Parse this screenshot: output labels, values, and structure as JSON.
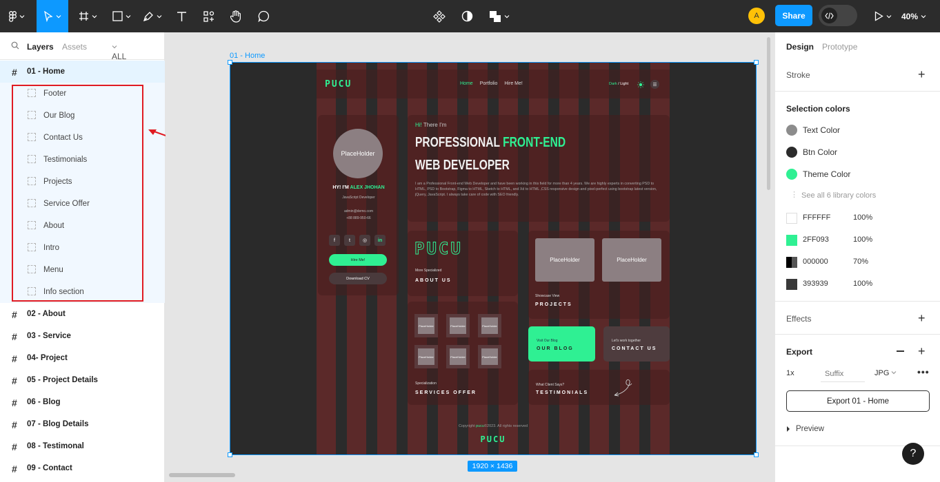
{
  "toolbar": {
    "share": "Share",
    "avatar": "A",
    "zoom": "40%"
  },
  "left": {
    "tab_layers": "Layers",
    "tab_assets": "Assets",
    "pages": "ALL page",
    "layers": [
      {
        "label": "01 - Home"
      },
      {
        "label": "Footer"
      },
      {
        "label": "Our Blog"
      },
      {
        "label": "Contact Us"
      },
      {
        "label": "Testimonials"
      },
      {
        "label": "Projects"
      },
      {
        "label": "Service Offer"
      },
      {
        "label": "About"
      },
      {
        "label": "Intro"
      },
      {
        "label": "Menu"
      },
      {
        "label": "Info section"
      },
      {
        "label": "02 - About"
      },
      {
        "label": "03 - Service"
      },
      {
        "label": "04- Project"
      },
      {
        "label": "05 - Project Details"
      },
      {
        "label": "06 - Blog"
      },
      {
        "label": "07 - Blog Details"
      },
      {
        "label": "08 - Testimonal"
      },
      {
        "label": "09 - Contact"
      }
    ]
  },
  "canvas": {
    "frame_label": "01 - Home",
    "size_badge": "1920 × 1436"
  },
  "design": {
    "logo": "PUCU",
    "nav": [
      "Home",
      "Portfolio",
      "Hire Me!"
    ],
    "theme_dark": "Dark",
    "theme_sep": " / ",
    "theme_light": "Light",
    "placeholder": "PlaceHolder",
    "profile_greet": "HY! I'M",
    "profile_name": "ALEX JHOHAN",
    "profile_role": "JavaScript Developer",
    "profile_email": "admin@demo.com",
    "profile_phone": "+88 889-950-66",
    "hire_btn": "Hire Me!",
    "cv_btn": "Download CV",
    "hi": "Hi!",
    "hi_rest": " There I'm",
    "headline_1": "PROFESSIONAL",
    "headline_2": "FRONT-END",
    "headline_3": "WEB DEVELOPER",
    "intro_text": "I am a Professional Front-end Web Developer and have been working in this field for more than 4 years. We are highly experts in converting PSD to HTML, PSD to Bootstrap, Figma to HTML, Sketch to HTML, and Xd to HTML ,CSS responsive design and pixel-perfect using bootstrap latest version, jQuery, JavaScript. I always take care of code with SEO friendly.",
    "about_small": "More Specialized",
    "about_cap": "ABOUT US",
    "projects_small": "Showcase View",
    "projects_cap": "PROJECTS",
    "services_small": "Specialization",
    "services_cap": "SERVICES OFFER",
    "blog_small": "Visit Our Blog",
    "blog_cap": "OUR BLOG",
    "contact_small": "Let's work together",
    "contact_cap": "CONTACT US",
    "testi_small": "What Client Says?",
    "testi_cap": "TESTIMONIALS",
    "copyright_pre": "Copyright ",
    "copyright_brand": "pucu",
    "copyright_post": "©2023. All rights reserved"
  },
  "right": {
    "tab_design": "Design",
    "tab_prototype": "Prototype",
    "stroke": "Stroke",
    "selection_colors": "Selection colors",
    "colors": [
      {
        "label": "Text Color",
        "hex": "#8c8c8c"
      },
      {
        "label": "Btn Color",
        "hex": "#2b2b2b"
      },
      {
        "label": "Theme Color",
        "hex": "#2ff093"
      }
    ],
    "see_all": "See all 6 library colors",
    "swatches": [
      {
        "hex": "FFFFFF",
        "opacity": "100%"
      },
      {
        "hex": "2FF093",
        "opacity": "100%"
      },
      {
        "hex": "000000",
        "opacity": "70%"
      },
      {
        "hex": "393939",
        "opacity": "100%"
      }
    ],
    "effects": "Effects",
    "export": "Export",
    "scale": "1x",
    "suffix_placeholder": "Suffix",
    "format": "JPG",
    "export_btn": "Export 01 - Home",
    "preview": "Preview",
    "help": "?"
  }
}
